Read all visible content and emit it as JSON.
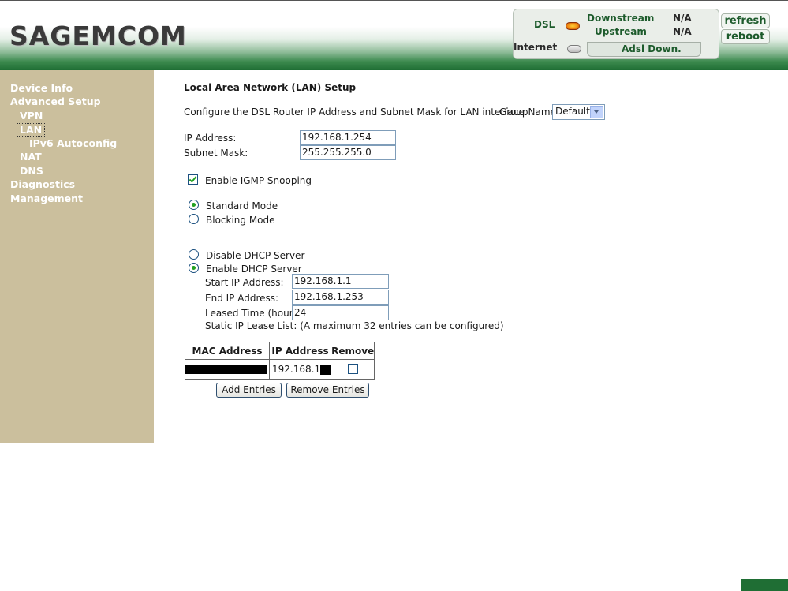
{
  "brand": "SAGEMCOM",
  "status": {
    "dsl_label": "DSL",
    "downstream_label": "Downstream",
    "downstream_value": "N/A",
    "upstream_label": "Upstream",
    "upstream_value": "N/A",
    "internet_label": "Internet",
    "line_status": "Adsl Down.",
    "refresh_label": "refresh",
    "reboot_label": "reboot"
  },
  "sidebar": {
    "items": [
      {
        "label": "Device Info"
      },
      {
        "label": "Advanced Setup"
      },
      {
        "label": "VPN"
      },
      {
        "label": "LAN"
      },
      {
        "label": "IPv6 Autoconfig"
      },
      {
        "label": "NAT"
      },
      {
        "label": "DNS"
      },
      {
        "label": "Diagnostics"
      },
      {
        "label": "Management"
      }
    ],
    "selected": "LAN"
  },
  "main": {
    "title": "Local Area Network (LAN) Setup",
    "description": "Configure the DSL Router IP Address and Subnet Mask for LAN interface.",
    "group_label": "GroupName",
    "group_value": "Default",
    "ip_label": "IP Address:",
    "ip_value": "192.168.1.254",
    "mask_label": "Subnet Mask:",
    "mask_value": "255.255.255.0",
    "igmp_label": "Enable IGMP Snooping",
    "igmp_checked": true,
    "standard_mode_label": "Standard Mode",
    "blocking_mode_label": "Blocking Mode",
    "disable_dhcp_label": "Disable DHCP Server",
    "enable_dhcp_label": "Enable DHCP Server",
    "start_ip_label": "Start IP Address:",
    "start_ip_value": "192.168.1.1",
    "end_ip_label": "End IP Address:",
    "end_ip_value": "192.168.1.253",
    "lease_label": "Leased Time (hour):",
    "lease_value": "24",
    "static_list_label": "Static IP Lease List: (A maximum 32 entries can be configured)",
    "table": {
      "headers": [
        "MAC Address",
        "IP Address",
        "Remove"
      ],
      "rows": [
        {
          "ip": "192.168.1"
        }
      ]
    },
    "add_entries_label": "Add Entries",
    "remove_entries_label": "Remove Entries"
  },
  "colors": {
    "header_green": "#1f6e34",
    "sidebar": "#cbbf9d",
    "check_green": "#21a121"
  },
  "icons": [
    "dsl-led-icon",
    "internet-led-icon",
    "dropdown-arrow-icon",
    "checkbox-icon",
    "radio-icon"
  ]
}
